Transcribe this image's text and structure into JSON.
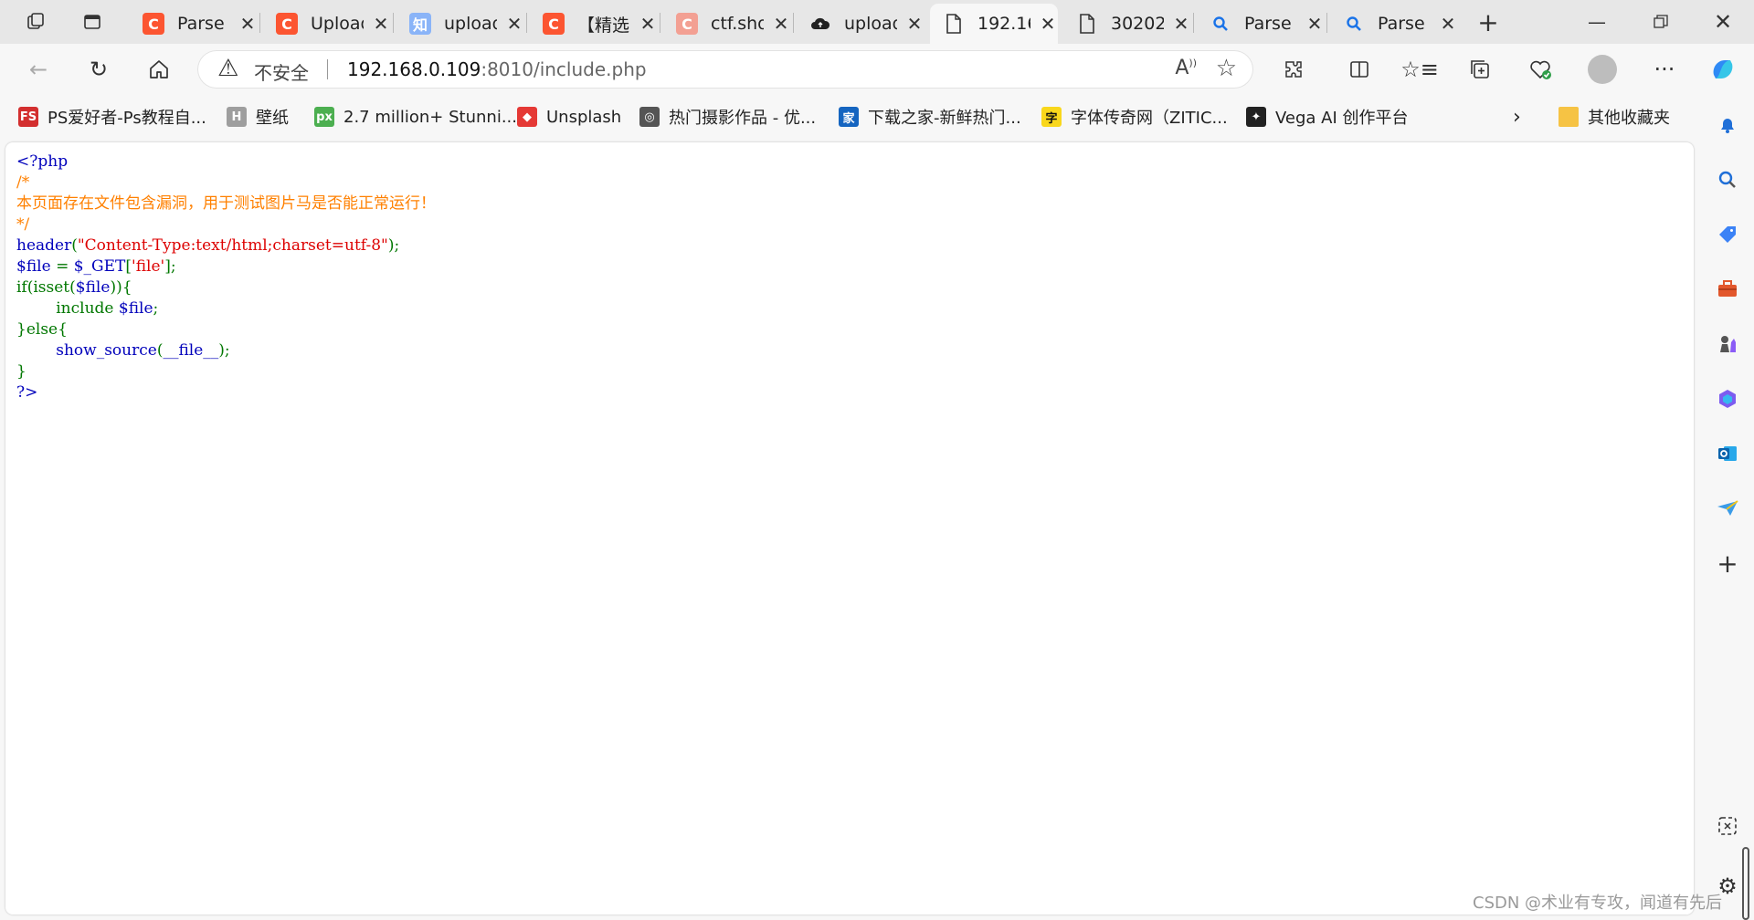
{
  "tabs": [
    {
      "label": "Parse",
      "favicon": "C",
      "color": "#fc5531"
    },
    {
      "label": "Upload",
      "favicon": "C",
      "color": "#fc5531"
    },
    {
      "label": "upload",
      "favicon": "知",
      "color": "#8ab4f8"
    },
    {
      "label": "【精选",
      "favicon": "C",
      "color": "#fc5531"
    },
    {
      "label": "ctf.sho",
      "favicon": "C",
      "color": "#f3a093"
    },
    {
      "label": "upload",
      "favicon": "cloud-icon",
      "color": "#222222"
    },
    {
      "label": "192.16",
      "favicon": "page-icon",
      "color": "#333333",
      "active": true
    },
    {
      "label": "30202",
      "favicon": "page-icon",
      "color": "#333333"
    },
    {
      "label": "Parse",
      "favicon": "search-icon",
      "color": "#1a73e8"
    },
    {
      "label": "Parse",
      "favicon": "search-icon",
      "color": "#1a73e8"
    }
  ],
  "address": {
    "security_label": "不安全",
    "host": "192.168.0.109",
    "rest": ":8010/include.php"
  },
  "bookmarks": [
    {
      "label": "PS爱好者-Ps教程自...",
      "icon": "FS",
      "color": "#d32f2f"
    },
    {
      "label": "壁纸",
      "icon": "H",
      "color": "#9e9e9e"
    },
    {
      "label": "2.7 million+ Stunni...",
      "icon": "px",
      "color": "#4caf50"
    },
    {
      "label": "Unsplash",
      "icon": "◆",
      "color": "#e53935"
    },
    {
      "label": "热门摄影作品 - 优...",
      "icon": "◎",
      "color": "#555555"
    },
    {
      "label": "下载之家-新鲜热门...",
      "icon": "家",
      "color": "#1565c0"
    },
    {
      "label": "字体传奇网（ZITIC...",
      "icon": "字",
      "color": "#f9d71c"
    },
    {
      "label": "Vega AI 创作平台",
      "icon": "✦",
      "color": "#222222"
    }
  ],
  "other_bookmarks": "其他收藏夹",
  "code_lines": [
    [
      {
        "t": "<?php",
        "c": "default"
      }
    ],
    [
      {
        "t": "/*",
        "c": "comment"
      }
    ],
    [
      {
        "t": "本页面存在文件包含漏洞，用于测试图片马是否能正常运行！",
        "c": "comment"
      }
    ],
    [
      {
        "t": "*/",
        "c": "comment"
      }
    ],
    [
      {
        "t": "header",
        "c": "default"
      },
      {
        "t": "(",
        "c": "keyword"
      },
      {
        "t": "\"Content-Type:text/html;charset=utf-8\"",
        "c": "string"
      },
      {
        "t": ");",
        "c": "keyword"
      }
    ],
    [
      {
        "t": "$file ",
        "c": "default"
      },
      {
        "t": "= ",
        "c": "keyword"
      },
      {
        "t": "$_GET",
        "c": "default"
      },
      {
        "t": "[",
        "c": "keyword"
      },
      {
        "t": "'file'",
        "c": "string"
      },
      {
        "t": "];",
        "c": "keyword"
      }
    ],
    [
      {
        "t": "if(isset(",
        "c": "keyword"
      },
      {
        "t": "$file",
        "c": "default"
      },
      {
        "t": ")){",
        "c": "keyword"
      }
    ],
    [
      {
        "t": "        include ",
        "c": "keyword"
      },
      {
        "t": "$file",
        "c": "default"
      },
      {
        "t": ";",
        "c": "keyword"
      }
    ],
    [
      {
        "t": "}else{",
        "c": "keyword"
      }
    ],
    [
      {
        "t": "        ",
        "c": "keyword"
      },
      {
        "t": "show_source",
        "c": "default"
      },
      {
        "t": "(",
        "c": "keyword"
      },
      {
        "t": "__file__",
        "c": "default"
      },
      {
        "t": ");",
        "c": "keyword"
      }
    ],
    [
      {
        "t": "}",
        "c": "keyword"
      }
    ],
    [
      {
        "t": "?>",
        "c": "default"
      }
    ]
  ],
  "watermark": "CSDN @术业有专攻，闻道有先后",
  "colors": {
    "default": "#0000bb",
    "comment": "#ff8000",
    "keyword": "#007700",
    "string": "#dd0000"
  }
}
